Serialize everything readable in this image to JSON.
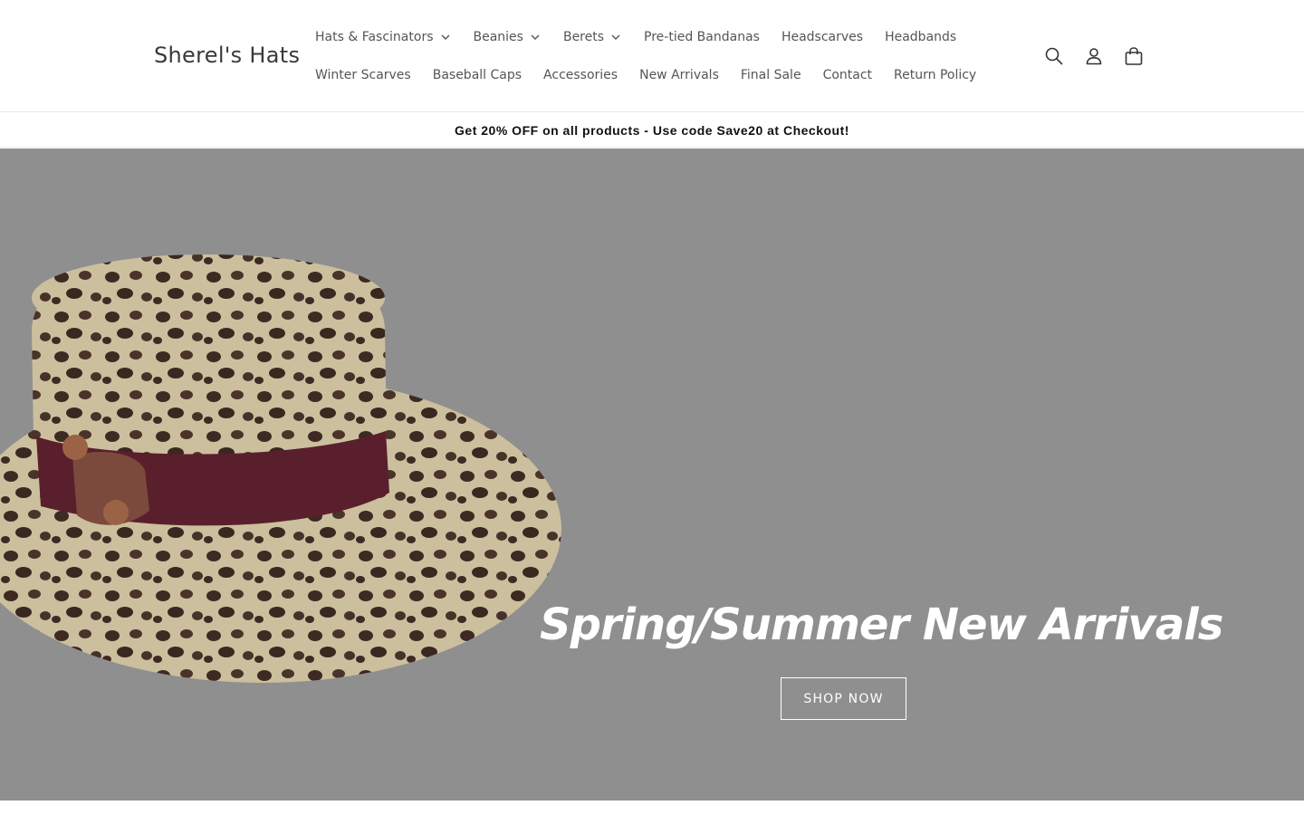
{
  "brand": {
    "name": "Sherel's Hats"
  },
  "nav": {
    "row1": [
      {
        "label": "Hats & Fascinators",
        "dropdown": true
      },
      {
        "label": "Beanies",
        "dropdown": true
      },
      {
        "label": "Berets",
        "dropdown": true
      },
      {
        "label": "Pre-tied Bandanas",
        "dropdown": false
      },
      {
        "label": "Headscarves",
        "dropdown": false
      },
      {
        "label": "Headbands",
        "dropdown": false
      }
    ],
    "row2": [
      {
        "label": "Winter Scarves"
      },
      {
        "label": "Baseball Caps"
      },
      {
        "label": "Accessories"
      },
      {
        "label": "New Arrivals"
      },
      {
        "label": "Final Sale"
      },
      {
        "label": "Contact"
      },
      {
        "label": "Return Policy"
      }
    ]
  },
  "header_icons": [
    "search-icon",
    "account-icon",
    "cart-icon"
  ],
  "announcement": {
    "text": "Get 20% OFF on all products - Use code Save20 at Checkout!"
  },
  "hero": {
    "title": "Spring/Summer New Arrivals",
    "cta_label": "SHOP NOW",
    "background_color": "#8f8f8f"
  },
  "colors": {
    "text": "#333333",
    "nav_text": "#555555",
    "hero_text": "#ffffff"
  }
}
